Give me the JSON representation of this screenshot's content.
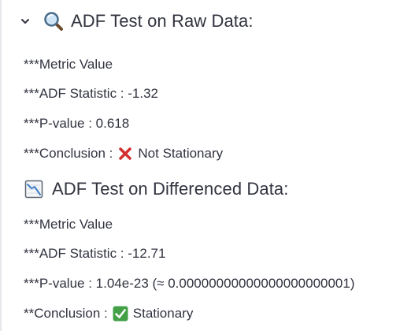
{
  "raw_section": {
    "header": "ADF Test on Raw Data:",
    "chevron_icon": "chevron-down-icon",
    "header_icon": "magnifier-emoji-icon",
    "metric_line": "***Metric Value",
    "stat_line": "***ADF Statistic : -1.32",
    "pvalue_line": "***P-value : 0.618",
    "conclusion_prefix": "***Conclusion :",
    "conclusion_icon": "cross-mark-icon",
    "conclusion_text": "Not Stationary"
  },
  "diff_section": {
    "header": "ADF Test on Differenced Data:",
    "header_icon": "chart-decreasing-emoji-icon",
    "metric_line": "***Metric Value",
    "stat_line": "***ADF Statistic : -12.71",
    "pvalue_line": "***P-value : 1.04e-23 (≈ 0.00000000000000000000001)",
    "conclusion_prefix": "**Conclusion :",
    "conclusion_icon": "check-mark-button-icon",
    "conclusion_text": "Stationary"
  },
  "colors": {
    "text": "#31333f",
    "cross_red": "#d32f2f",
    "check_green": "#43a047",
    "accent_bar": "#e6e7ea"
  }
}
